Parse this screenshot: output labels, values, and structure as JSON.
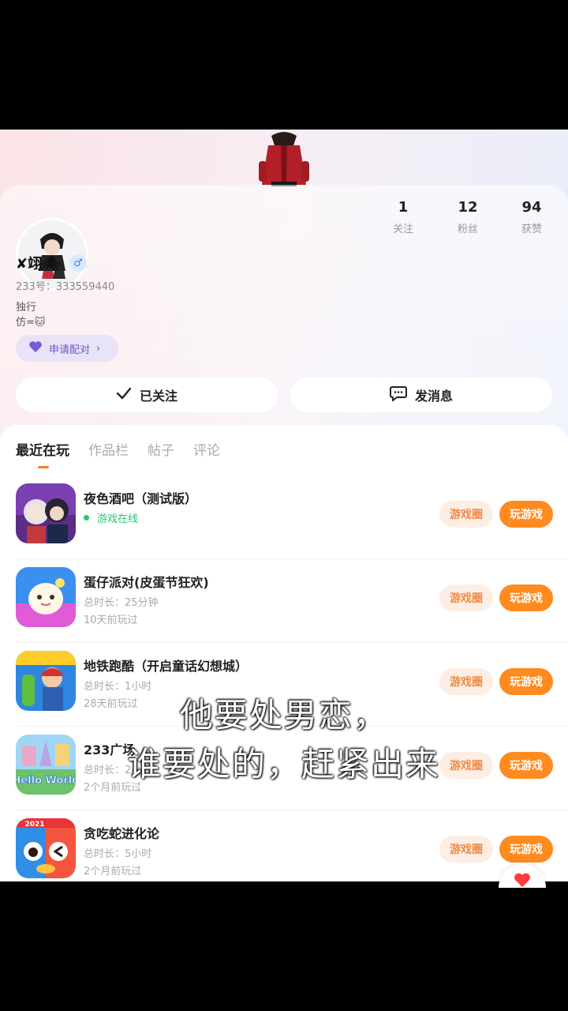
{
  "profile": {
    "nickname": "✘翊🕷",
    "gender_symbol": "♂",
    "uid_text": "233号：333559440",
    "bio_line1": "独行",
    "bio_line2": "仿=🐱",
    "pair_label": "申请配对",
    "stats": [
      {
        "num": "1",
        "label": "关注"
      },
      {
        "num": "12",
        "label": "粉丝"
      },
      {
        "num": "94",
        "label": "获赞"
      }
    ],
    "follow_label": "已关注",
    "message_label": "发消息"
  },
  "tabs": [
    "最近在玩",
    "作品栏",
    "帖子",
    "评论"
  ],
  "games": [
    {
      "title": "夜色酒吧（测试版）",
      "online": "游戏在线",
      "duration": "",
      "last_played": "",
      "circle": "游戏圈",
      "play": "玩游戏"
    },
    {
      "title": "蛋仔派对(皮蛋节狂欢)",
      "online": "",
      "duration": "总时长：25分钟",
      "last_played": "10天前玩过",
      "circle": "游戏圈",
      "play": "玩游戏"
    },
    {
      "title": "地铁跑酷（开启童话幻想城）",
      "online": "",
      "duration": "总时长：1小时",
      "last_played": "28天前玩过",
      "circle": "游戏圈",
      "play": "玩游戏"
    },
    {
      "title": "233广场",
      "online": "",
      "duration": "总时长：2小时",
      "last_played": "2个月前玩过",
      "circle": "游戏圈",
      "play": "玩游戏"
    },
    {
      "title": "贪吃蛇进化论",
      "online": "",
      "duration": "总时长：5小时",
      "last_played": "2个月前玩过",
      "circle": "游戏圈",
      "play": "玩游戏"
    }
  ],
  "icon_texts": {
    "game4": "Hello World",
    "game5": "2021"
  },
  "subtitles": [
    "他要处男恋，",
    "谁要处的，赶紧出来"
  ],
  "colors": {
    "accent": "#ff8a1f",
    "online": "#28c76f",
    "pair": "#6a54c9"
  }
}
